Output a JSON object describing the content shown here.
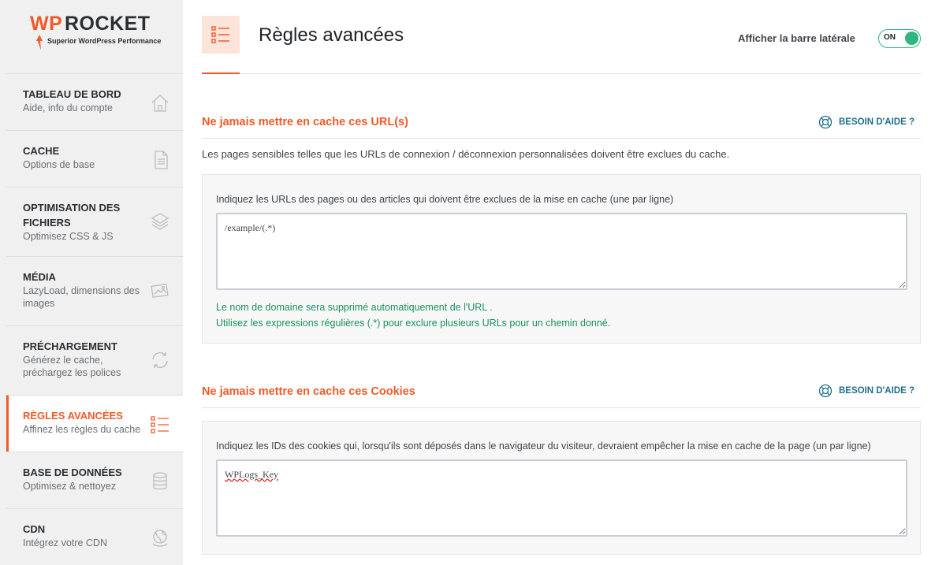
{
  "logo": {
    "wp": "WP",
    "rocket": "ROCKET",
    "tagline": "Superior WordPress Performance"
  },
  "sidebar": {
    "items": [
      {
        "title": "TABLEAU DE BORD",
        "subtitle": "Aide, info du compte",
        "icon": "home-icon"
      },
      {
        "title": "CACHE",
        "subtitle": "Options de base",
        "icon": "document-icon"
      },
      {
        "title": "OPTIMISATION DES FICHIERS",
        "subtitle": "Optimisez CSS & JS",
        "icon": "layers-icon"
      },
      {
        "title": "MÉDIA",
        "subtitle": "LazyLoad, dimensions des images",
        "icon": "image-icon"
      },
      {
        "title": "PRÉCHARGEMENT",
        "subtitle": "Générez le cache, préchargez les polices",
        "icon": "refresh-icon"
      },
      {
        "title": "RÈGLES AVANCÉES",
        "subtitle": "Affinez les règles du cache",
        "icon": "list-icon",
        "active": true
      },
      {
        "title": "BASE DE DONNÉES",
        "subtitle": "Optimisez & nettoyez",
        "icon": "database-icon"
      },
      {
        "title": "CDN",
        "subtitle": "Intégrez votre CDN",
        "icon": "globe-icon"
      }
    ]
  },
  "header": {
    "title": "Règles avancées",
    "sidebar_toggle_label": "Afficher la barre latérale",
    "sidebar_toggle_state": "ON"
  },
  "sections": [
    {
      "title": "Ne jamais mettre en cache ces URL(s)",
      "help": "BESOIN D'AIDE ?",
      "description": "Les pages sensibles telles que les URLs de connexion / déconnexion personnalisées doivent être exclues du cache.",
      "field_label": "Indiquez les URLs des pages ou des articles qui doivent être exclues de la mise en cache (une par ligne)",
      "field_value": "/example/(.*)",
      "hint1": "Le nom de domaine sera supprimé automatiquement de l'URL .",
      "hint2": "Utilisez les expressions régulières (.*) pour exclure plusieurs URLs pour un chemin donné."
    },
    {
      "title": "Ne jamais mettre en cache ces Cookies",
      "help": "BESOIN D'AIDE ?",
      "field_label": "Indiquez les IDs des cookies qui, lorsqu'ils sont déposés dans le navigateur du visiteur, devraient empêcher la mise en cache de la page (un par ligne)",
      "field_value": "WPLogs_Key"
    }
  ],
  "colors": {
    "accent": "#f05a28",
    "toggle": "#2fb683",
    "help": "#1f6f8b",
    "hint": "#18925d"
  }
}
